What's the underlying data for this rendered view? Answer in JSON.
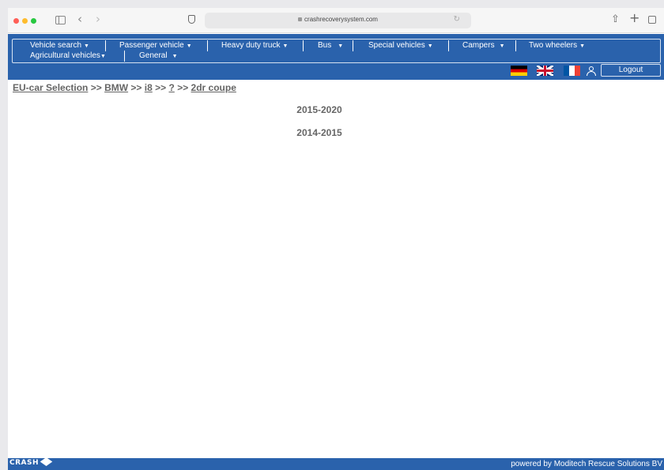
{
  "browser": {
    "url": "crashrecoverysystem.com"
  },
  "nav": {
    "items": [
      {
        "label": "Vehicle search"
      },
      {
        "label": "Passenger vehicle"
      },
      {
        "label": "Heavy duty truck"
      },
      {
        "label": "Bus"
      },
      {
        "label": "Special vehicles"
      },
      {
        "label": "Campers"
      },
      {
        "label": "Two wheelers"
      },
      {
        "label": "Agricultural vehicles"
      },
      {
        "label": "General"
      }
    ],
    "caret": "▼",
    "logout_label": "Logout",
    "flags": [
      "de-flag-icon",
      "uk-flag-icon",
      "fr-flag-icon"
    ],
    "colors": {
      "nav_bg": "#2a62ac"
    }
  },
  "breadcrumb": {
    "eu_car_selection": "EU-car Selection",
    "sep": ">>",
    "brand": "BMW",
    "model": "i8",
    "unknown": "?",
    "body": "2dr coupe"
  },
  "years": [
    "2015-2020",
    "2014-2015"
  ],
  "footer": {
    "logo_text": "CRASH",
    "powered_by": "powered by Moditech Rescue Solutions BV"
  }
}
